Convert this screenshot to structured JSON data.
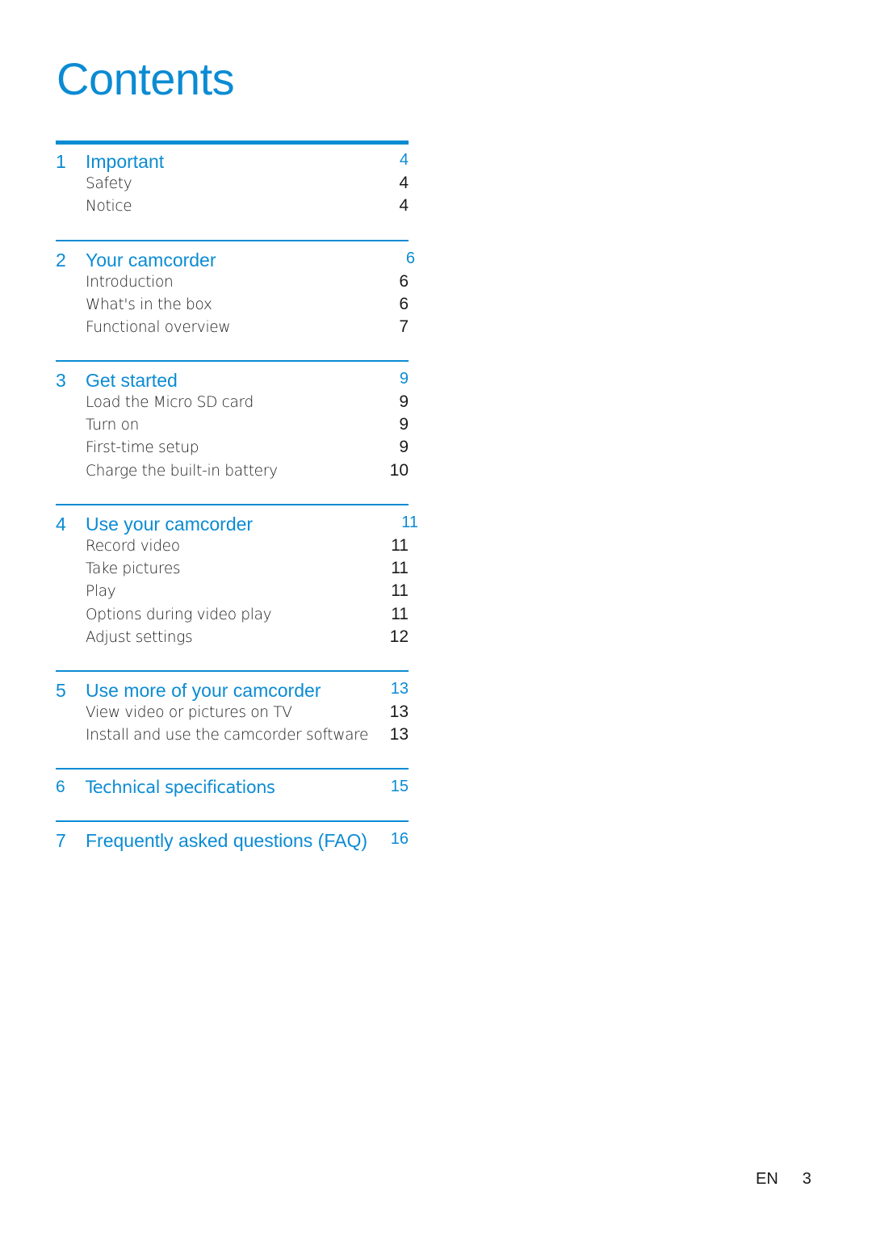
{
  "title": "Contents",
  "accent_color": "#0b8bd3",
  "sections": [
    {
      "number": "1",
      "label": "Important",
      "page": "4",
      "items": [
        {
          "label": "Safety",
          "page": "4"
        },
        {
          "label": "Notice",
          "page": "4"
        }
      ]
    },
    {
      "number": "2",
      "label": "Your camcorder",
      "page": "6",
      "items": [
        {
          "label": "Introduction",
          "page": "6"
        },
        {
          "label": "What's in the box",
          "page": "6"
        },
        {
          "label": "Functional overview",
          "page": "7"
        }
      ]
    },
    {
      "number": "3",
      "label": "Get started",
      "page": "9",
      "items": [
        {
          "label": "Load the Micro SD card",
          "page": "9"
        },
        {
          "label": "Turn on",
          "page": "9"
        },
        {
          "label": "First-time setup",
          "page": "9"
        },
        {
          "label": "Charge the built-in battery",
          "page": "10"
        }
      ]
    },
    {
      "number": "4",
      "label": "Use your camcorder",
      "page": "11",
      "items": [
        {
          "label": "Record video",
          "page": "11"
        },
        {
          "label": "Take pictures",
          "page": "11"
        },
        {
          "label": "Play",
          "page": "11"
        },
        {
          "label": "Options during video play",
          "page": "11"
        },
        {
          "label": "Adjust settings",
          "page": "12"
        }
      ]
    },
    {
      "number": "5",
      "label": "Use more of your camcorder",
      "page": "13",
      "items": [
        {
          "label": "View video or pictures on TV",
          "page": "13"
        },
        {
          "label": "Install and use the camcorder software",
          "page": "13"
        }
      ]
    },
    {
      "number": "6",
      "label": "Technical specifications",
      "page": "15",
      "items": []
    },
    {
      "number": "7",
      "label": "Frequently asked questions (FAQ)",
      "page": "16",
      "items": []
    }
  ],
  "footer": {
    "language": "EN",
    "page_number": "3"
  }
}
